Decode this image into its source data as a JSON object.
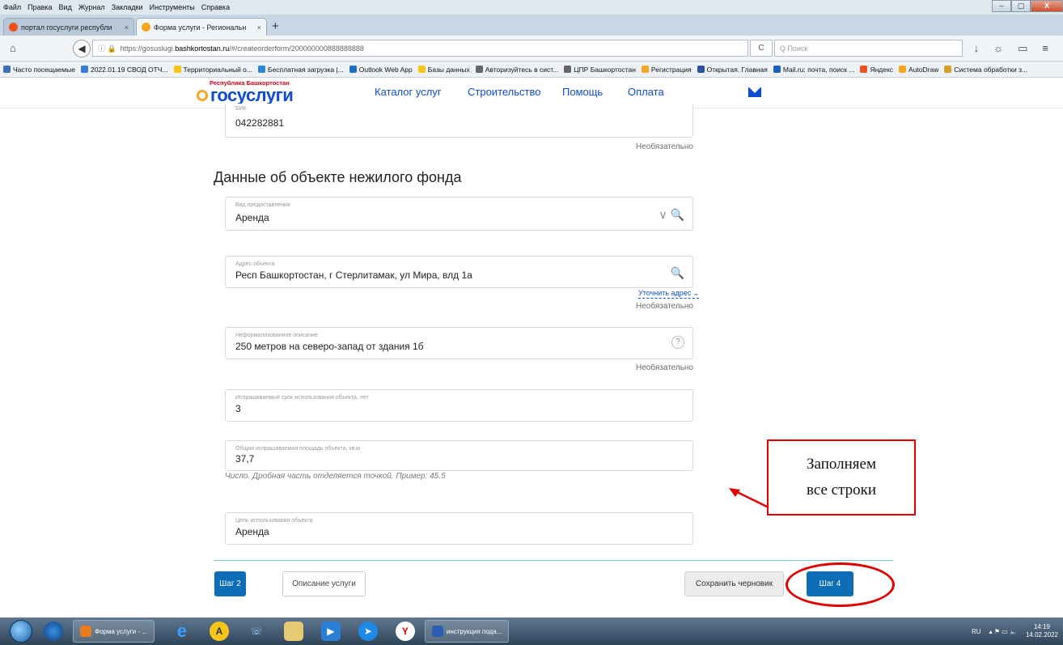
{
  "browser": {
    "menu": [
      "Файл",
      "Правка",
      "Вид",
      "Журнал",
      "Закладки",
      "Инструменты",
      "Справка"
    ],
    "window_controls": {
      "minimize": "–",
      "maximize": "▢",
      "close": "X"
    },
    "tabs": [
      {
        "label": "портал госуслуги республи",
        "close": "×",
        "color": "#f1511b"
      },
      {
        "label": "Форма услуги - Региональн",
        "close": "×",
        "color": "#f5a623"
      }
    ],
    "new_tab": "+",
    "url_icons": "ⓘ 🔒",
    "url_prefix": "https://gosuslugi.",
    "url_domain": "bashkortostan.ru",
    "url_suffix": "/#/createorderform/200000000888888888",
    "reload": "C",
    "search_placeholder": "Q Поиск",
    "toolbar_icons": [
      "↓",
      "☼",
      "▭",
      "≡"
    ],
    "bookmarks": [
      {
        "label": "Часто посещаемые",
        "color": "#3b6fb6"
      },
      {
        "label": "2022.01.19 СВОД ОТЧ...",
        "color": "#3b7bd6"
      },
      {
        "label": "Территориальный о...",
        "color": "#f5c518"
      },
      {
        "label": "Бесплатная загрузка |...",
        "color": "#2a86d8"
      },
      {
        "label": "Outlook Web App",
        "color": "#1f6fc0"
      },
      {
        "label": "Базы данных",
        "color": "#f5c518"
      },
      {
        "label": "Авторизуйтесь в сист...",
        "color": "#666666"
      },
      {
        "label": "ЦПР Башкортостан",
        "color": "#666666"
      },
      {
        "label": "Регистрация",
        "color": "#f5a623"
      },
      {
        "label": "Открытая. Главная",
        "color": "#3050a0"
      },
      {
        "label": "Mail.ru: почта, поиск ...",
        "color": "#1f5fc0"
      },
      {
        "label": "Яндекс",
        "color": "#f1511b"
      },
      {
        "label": "AutoDraw",
        "color": "#f5a623"
      },
      {
        "label": "Система обработки з...",
        "color": "#d8a020"
      }
    ]
  },
  "site": {
    "logo_sub": "Республика Башкортостан",
    "logo_main": "госуслуги",
    "nav": [
      "Каталог услуг",
      "Строительство",
      "Помощь",
      "Оплата"
    ]
  },
  "form": {
    "bik": {
      "label": "БИК",
      "value": "042282881",
      "optional": "Необязательно"
    },
    "section_title": "Данные об объекте нежилого фонда",
    "kind": {
      "label": "Вид предоставления",
      "value": "Аренда",
      "icons": "∨ 🔍"
    },
    "address": {
      "label": "Адрес объекта",
      "value": "Респ Башкортостан, г Стерлитамак, ул Мира, влд 1а",
      "icon": "🔍",
      "clarify": "Уточнить адрес ⌄",
      "optional": "Необязательно"
    },
    "description": {
      "label": "Неформализованное описание",
      "value": "250 метров на северо-запад от здания 1б",
      "help": "?",
      "optional": "Необязательно"
    },
    "term": {
      "label": "Испрашиваемый срок использования объекта, лет",
      "value": "3"
    },
    "area": {
      "label": "Общая испрашиваемая площадь объекта, кв.м",
      "value": "37,7",
      "hint": "Число. Дробная часть отделяется точкой. Пример: 45.5"
    },
    "purpose": {
      "label": "Цель использования объекта",
      "value": "Аренда"
    }
  },
  "buttons": {
    "step2": "Шаг 2",
    "service_description": "Описание услуги",
    "save_draft": "Сохранить черновик",
    "step4": "Шаг 4"
  },
  "annotation": {
    "line1": "Заполняем",
    "line2": "все строки",
    "color": "#e00000"
  },
  "taskbar": {
    "tasks": [
      {
        "label": "Форма услуги - ...",
        "color": "#e87b1e"
      },
      {
        "label": "инструкция пода...",
        "color": "#2b5fb4"
      }
    ],
    "lang": "RU",
    "time": "14:19",
    "date": "14.02.2022"
  }
}
